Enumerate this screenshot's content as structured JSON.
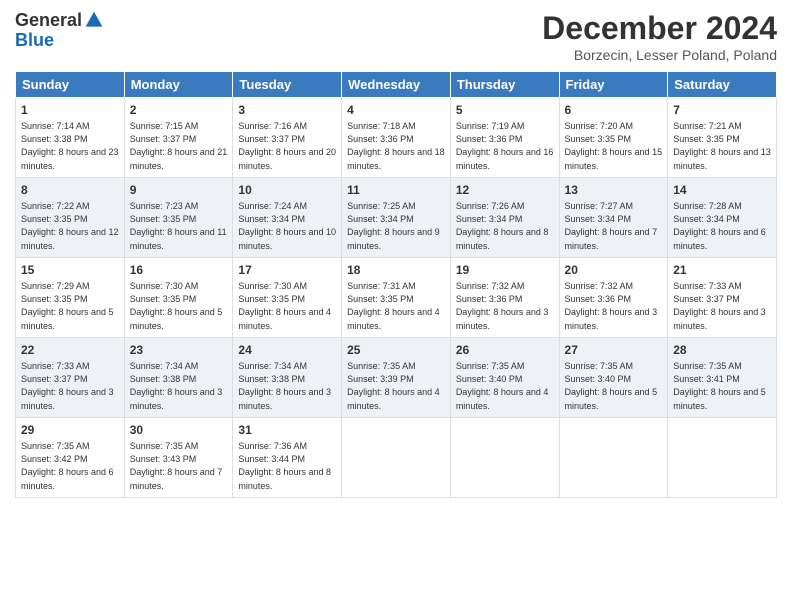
{
  "logo": {
    "general": "General",
    "blue": "Blue"
  },
  "title": "December 2024",
  "location": "Borzecin, Lesser Poland, Poland",
  "days_of_week": [
    "Sunday",
    "Monday",
    "Tuesday",
    "Wednesday",
    "Thursday",
    "Friday",
    "Saturday"
  ],
  "weeks": [
    [
      {
        "day": "1",
        "sunrise": "7:14 AM",
        "sunset": "3:38 PM",
        "daylight": "8 hours and 23 minutes."
      },
      {
        "day": "2",
        "sunrise": "7:15 AM",
        "sunset": "3:37 PM",
        "daylight": "8 hours and 21 minutes."
      },
      {
        "day": "3",
        "sunrise": "7:16 AM",
        "sunset": "3:37 PM",
        "daylight": "8 hours and 20 minutes."
      },
      {
        "day": "4",
        "sunrise": "7:18 AM",
        "sunset": "3:36 PM",
        "daylight": "8 hours and 18 minutes."
      },
      {
        "day": "5",
        "sunrise": "7:19 AM",
        "sunset": "3:36 PM",
        "daylight": "8 hours and 16 minutes."
      },
      {
        "day": "6",
        "sunrise": "7:20 AM",
        "sunset": "3:35 PM",
        "daylight": "8 hours and 15 minutes."
      },
      {
        "day": "7",
        "sunrise": "7:21 AM",
        "sunset": "3:35 PM",
        "daylight": "8 hours and 13 minutes."
      }
    ],
    [
      {
        "day": "8",
        "sunrise": "7:22 AM",
        "sunset": "3:35 PM",
        "daylight": "8 hours and 12 minutes."
      },
      {
        "day": "9",
        "sunrise": "7:23 AM",
        "sunset": "3:35 PM",
        "daylight": "8 hours and 11 minutes."
      },
      {
        "day": "10",
        "sunrise": "7:24 AM",
        "sunset": "3:34 PM",
        "daylight": "8 hours and 10 minutes."
      },
      {
        "day": "11",
        "sunrise": "7:25 AM",
        "sunset": "3:34 PM",
        "daylight": "8 hours and 9 minutes."
      },
      {
        "day": "12",
        "sunrise": "7:26 AM",
        "sunset": "3:34 PM",
        "daylight": "8 hours and 8 minutes."
      },
      {
        "day": "13",
        "sunrise": "7:27 AM",
        "sunset": "3:34 PM",
        "daylight": "8 hours and 7 minutes."
      },
      {
        "day": "14",
        "sunrise": "7:28 AM",
        "sunset": "3:34 PM",
        "daylight": "8 hours and 6 minutes."
      }
    ],
    [
      {
        "day": "15",
        "sunrise": "7:29 AM",
        "sunset": "3:35 PM",
        "daylight": "8 hours and 5 minutes."
      },
      {
        "day": "16",
        "sunrise": "7:30 AM",
        "sunset": "3:35 PM",
        "daylight": "8 hours and 5 minutes."
      },
      {
        "day": "17",
        "sunrise": "7:30 AM",
        "sunset": "3:35 PM",
        "daylight": "8 hours and 4 minutes."
      },
      {
        "day": "18",
        "sunrise": "7:31 AM",
        "sunset": "3:35 PM",
        "daylight": "8 hours and 4 minutes."
      },
      {
        "day": "19",
        "sunrise": "7:32 AM",
        "sunset": "3:36 PM",
        "daylight": "8 hours and 3 minutes."
      },
      {
        "day": "20",
        "sunrise": "7:32 AM",
        "sunset": "3:36 PM",
        "daylight": "8 hours and 3 minutes."
      },
      {
        "day": "21",
        "sunrise": "7:33 AM",
        "sunset": "3:37 PM",
        "daylight": "8 hours and 3 minutes."
      }
    ],
    [
      {
        "day": "22",
        "sunrise": "7:33 AM",
        "sunset": "3:37 PM",
        "daylight": "8 hours and 3 minutes."
      },
      {
        "day": "23",
        "sunrise": "7:34 AM",
        "sunset": "3:38 PM",
        "daylight": "8 hours and 3 minutes."
      },
      {
        "day": "24",
        "sunrise": "7:34 AM",
        "sunset": "3:38 PM",
        "daylight": "8 hours and 3 minutes."
      },
      {
        "day": "25",
        "sunrise": "7:35 AM",
        "sunset": "3:39 PM",
        "daylight": "8 hours and 4 minutes."
      },
      {
        "day": "26",
        "sunrise": "7:35 AM",
        "sunset": "3:40 PM",
        "daylight": "8 hours and 4 minutes."
      },
      {
        "day": "27",
        "sunrise": "7:35 AM",
        "sunset": "3:40 PM",
        "daylight": "8 hours and 5 minutes."
      },
      {
        "day": "28",
        "sunrise": "7:35 AM",
        "sunset": "3:41 PM",
        "daylight": "8 hours and 5 minutes."
      }
    ],
    [
      {
        "day": "29",
        "sunrise": "7:35 AM",
        "sunset": "3:42 PM",
        "daylight": "8 hours and 6 minutes."
      },
      {
        "day": "30",
        "sunrise": "7:35 AM",
        "sunset": "3:43 PM",
        "daylight": "8 hours and 7 minutes."
      },
      {
        "day": "31",
        "sunrise": "7:36 AM",
        "sunset": "3:44 PM",
        "daylight": "8 hours and 8 minutes."
      },
      null,
      null,
      null,
      null
    ]
  ],
  "labels": {
    "sunrise": "Sunrise:",
    "sunset": "Sunset:",
    "daylight": "Daylight:"
  }
}
